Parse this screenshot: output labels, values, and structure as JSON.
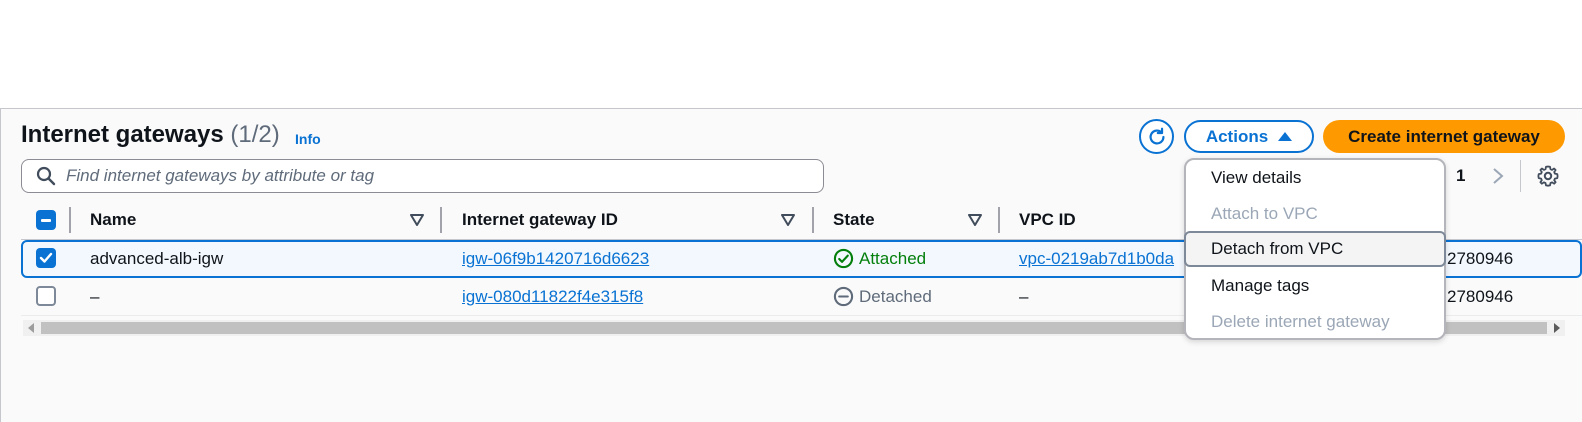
{
  "header": {
    "title": "Internet gateways",
    "count": "(1/2)",
    "info": "Info"
  },
  "toolbar": {
    "refresh_icon": "refresh-icon",
    "actions_label": "Actions",
    "create_label": "Create internet gateway"
  },
  "search": {
    "placeholder": "Find internet gateways by attribute or tag",
    "value": ""
  },
  "pagination": {
    "page": "1"
  },
  "table": {
    "columns": [
      "Name",
      "Internet gateway ID",
      "State",
      "VPC ID"
    ],
    "rows": [
      {
        "selected": true,
        "name": "advanced-alb-igw",
        "id": "igw-06f9b1420716d6623",
        "state": "Attached",
        "vpc": "vpc-0219ab7d1b0da",
        "owner_tail": "2780946"
      },
      {
        "selected": false,
        "name": "–",
        "id": "igw-080d11822f4e315f8",
        "state": "Detached",
        "vpc": "–",
        "owner_tail": "2780946"
      }
    ]
  },
  "actions_menu": {
    "items": [
      {
        "label": "View details",
        "disabled": false
      },
      {
        "label": "Attach to VPC",
        "disabled": true
      },
      {
        "label": "Detach from VPC",
        "disabled": false,
        "hovered": true
      },
      {
        "label": "Manage tags",
        "disabled": false
      },
      {
        "label": "Delete internet gateway",
        "disabled": true
      }
    ]
  },
  "colors": {
    "primary": "#0972d3",
    "create_button": "#ff9900",
    "status_attached": "#037f0c",
    "status_detached": "#5f6b7a"
  }
}
